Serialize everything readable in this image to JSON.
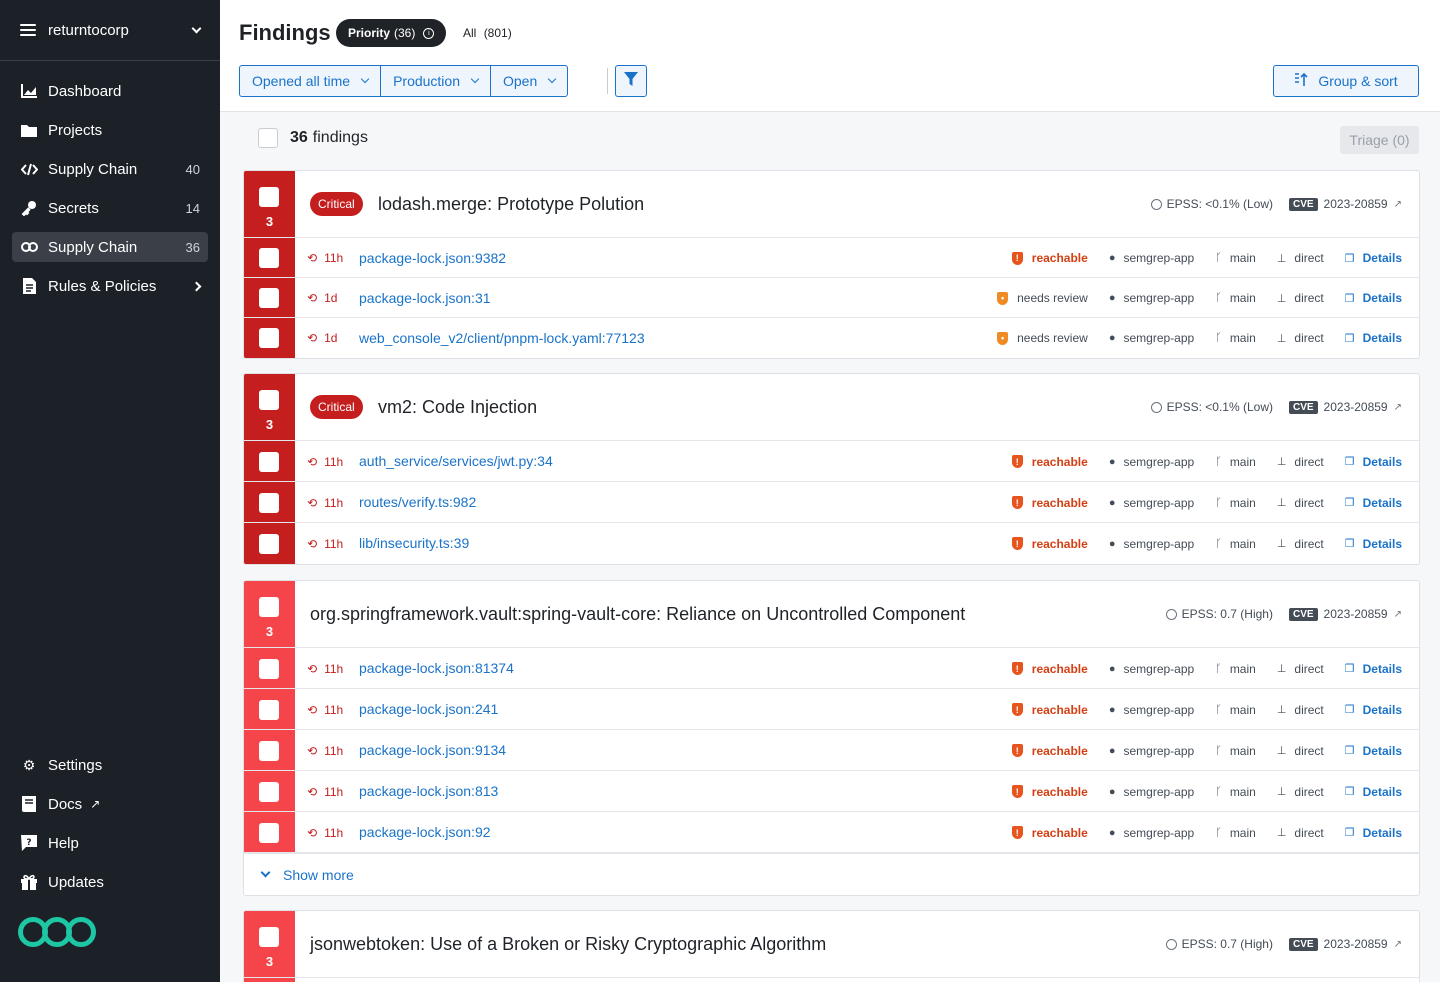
{
  "org": {
    "name": "returntocorp"
  },
  "nav": [
    {
      "label": "Dashboard",
      "count": ""
    },
    {
      "label": "Projects",
      "count": ""
    },
    {
      "label": "Supply Chain",
      "count": "40"
    },
    {
      "label": "Secrets",
      "count": "14"
    },
    {
      "label": "Supply Chain",
      "count": "36"
    },
    {
      "label": "Rules & Policies",
      "count": ""
    }
  ],
  "nav_bottom": [
    {
      "label": "Settings"
    },
    {
      "label": "Docs"
    },
    {
      "label": "Help"
    },
    {
      "label": "Updates"
    }
  ],
  "header": {
    "title": "Findings",
    "priority_label": "Priority",
    "priority_count": "(36)",
    "all_label": "All",
    "all_count": "(801)",
    "filters": [
      "Opened all time",
      "Production",
      "Open"
    ],
    "group_sort": "Group & sort"
  },
  "list": {
    "count": "36",
    "count_label": "findings",
    "triage": "Triage (0)"
  },
  "groups": [
    {
      "count": "3",
      "severity": "Critical",
      "title": "lodash.merge: Prototype Polution",
      "epss": "EPSS: <0.1% (Low)",
      "cve_badge": "CVE",
      "cve": "2023-20859",
      "rows": [
        {
          "age": "11h",
          "file": "package-lock.json:9382",
          "status": "reachable",
          "repo": "semgrep-app",
          "branch": "main",
          "dep": "direct",
          "details": "Details"
        },
        {
          "age": "1d",
          "file": "package-lock.json:31",
          "status": "needs review",
          "repo": "semgrep-app",
          "branch": "main",
          "dep": "direct",
          "details": "Details"
        },
        {
          "age": "1d",
          "file": "web_console_v2/client/pnpm-lock.yaml:77123",
          "status": "needs review",
          "repo": "semgrep-app",
          "branch": "main",
          "dep": "direct",
          "details": "Details"
        }
      ]
    },
    {
      "count": "3",
      "severity": "Critical",
      "title": "vm2: Code Injection",
      "epss": "EPSS: <0.1% (Low)",
      "cve_badge": "CVE",
      "cve": "2023-20859",
      "rows": [
        {
          "age": "11h",
          "file": "auth_service/services/jwt.py:34",
          "status": "reachable",
          "repo": "semgrep-app",
          "branch": "main",
          "dep": "direct",
          "details": "Details"
        },
        {
          "age": "11h",
          "file": "routes/verify.ts:982",
          "status": "reachable",
          "repo": "semgrep-app",
          "branch": "main",
          "dep": "direct",
          "details": "Details"
        },
        {
          "age": "11h",
          "file": "lib/insecurity.ts:39",
          "status": "reachable",
          "repo": "semgrep-app",
          "branch": "main",
          "dep": "direct",
          "details": "Details"
        }
      ]
    },
    {
      "count": "3",
      "severity": "",
      "title": "org.springframework.vault:spring-vault-core: Reliance on Uncontrolled Component",
      "epss": "EPSS: 0.7 (High)",
      "cve_badge": "CVE",
      "cve": "2023-20859",
      "show_more": "Show more",
      "rows": [
        {
          "age": "11h",
          "file": "package-lock.json:81374",
          "status": "reachable",
          "repo": "semgrep-app",
          "branch": "main",
          "dep": "direct",
          "details": "Details"
        },
        {
          "age": "11h",
          "file": "package-lock.json:241",
          "status": "reachable",
          "repo": "semgrep-app",
          "branch": "main",
          "dep": "direct",
          "details": "Details"
        },
        {
          "age": "11h",
          "file": "package-lock.json:9134",
          "status": "reachable",
          "repo": "semgrep-app",
          "branch": "main",
          "dep": "direct",
          "details": "Details"
        },
        {
          "age": "11h",
          "file": "package-lock.json:813",
          "status": "reachable",
          "repo": "semgrep-app",
          "branch": "main",
          "dep": "direct",
          "details": "Details"
        },
        {
          "age": "11h",
          "file": "package-lock.json:92",
          "status": "reachable",
          "repo": "semgrep-app",
          "branch": "main",
          "dep": "direct",
          "details": "Details"
        }
      ]
    },
    {
      "count": "3",
      "severity": "",
      "title": "jsonwebtoken: Use of a Broken or Risky Cryptographic Algorithm",
      "epss": "EPSS: 0.7 (High)",
      "cve_badge": "CVE",
      "cve": "2023-20859",
      "rows": []
    }
  ],
  "colors": {
    "critical": "#c41e1e",
    "high": "#f5444a",
    "link": "#1a73c9",
    "reachable": "#d44013",
    "sidebar": "#1c2128",
    "logo": "#1ec6a3"
  }
}
